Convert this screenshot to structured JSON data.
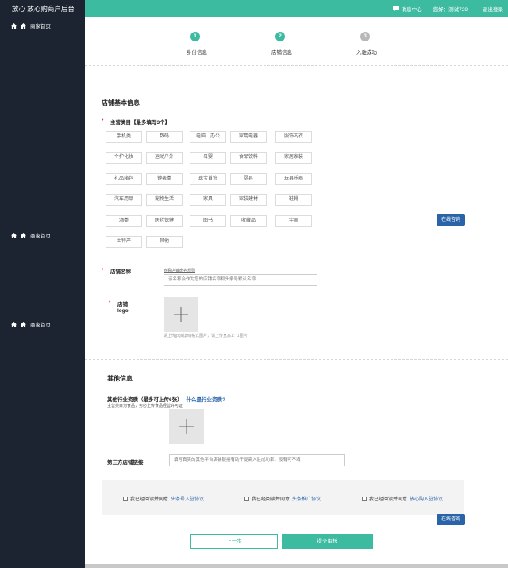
{
  "header": {
    "brand": "放心 放心购商户后台",
    "message_center": "消息中心",
    "greeting": "您好：测试729",
    "logout": "退出登录"
  },
  "sidebar": {
    "items": [
      {
        "label": "商家首页"
      },
      {
        "label": "商家首页"
      },
      {
        "label": "商家首页"
      }
    ]
  },
  "steps": [
    {
      "number": "1",
      "label": "身份信息",
      "state": "done"
    },
    {
      "number": "2",
      "label": "店铺信息",
      "state": "active"
    },
    {
      "number": "3",
      "label": "入驻成功",
      "state": "pending"
    }
  ],
  "shop_basic": {
    "title": "店铺基本信息",
    "category_label": "主营类目【最多填写3个】",
    "categories": [
      [
        "手机类",
        "数码",
        "电脑、办公",
        "家用电器",
        "服饰内衣"
      ],
      [
        "个护化妆",
        "运动户外",
        "母婴",
        "食品饮料",
        "家居家装"
      ],
      [
        "礼品箱包",
        "钟表类",
        "珠宝首饰",
        "厨具",
        "玩具乐器"
      ],
      [
        "汽车用品",
        "宠物生活",
        "家具",
        "家装建材",
        "鞋靴"
      ],
      [
        "酒类",
        "医药保健",
        "图书",
        "收藏品",
        "宇画"
      ],
      [
        "土特产",
        "其他"
      ]
    ],
    "consult_button": "在线咨询",
    "shop_name_label": "店铺名称",
    "shop_name_rule_link": "查看店铺命名规则",
    "shop_name_placeholder": "该名称会作为您的店铺名称和头条号默认名称",
    "logo_label_line1": "店铺",
    "logo_label_line2": "logo",
    "logo_hint": "请上传jpg或png格式图片，请上传宽高1：1图片"
  },
  "other_info": {
    "title": "其他信息",
    "qualification_label": "其他行业资质（最多可上传6张）",
    "qualification_link": "什么是行业资质?",
    "qualification_note": "主营类目为食品，务必上传食品经营许可证",
    "third_party_label": "第三方店铺链接",
    "third_party_placeholder": "填写真实的其他平台店铺链接有助于提高入驻成功率，没有可不填"
  },
  "agreements": [
    {
      "prefix": "我已经阅读并同意",
      "link": "头条号入驻协议"
    },
    {
      "prefix": "我已经阅读并同意",
      "link": "头条推广协议"
    },
    {
      "prefix": "我已经阅读并同意",
      "link": "放心购入驻协议"
    }
  ],
  "actions": {
    "consult_button": "在线咨询",
    "prev": "上一步",
    "submit": "提交审核"
  },
  "colors": {
    "accent": "#3dbba0",
    "sidebar": "#1b2430",
    "link": "#2a64a8"
  }
}
